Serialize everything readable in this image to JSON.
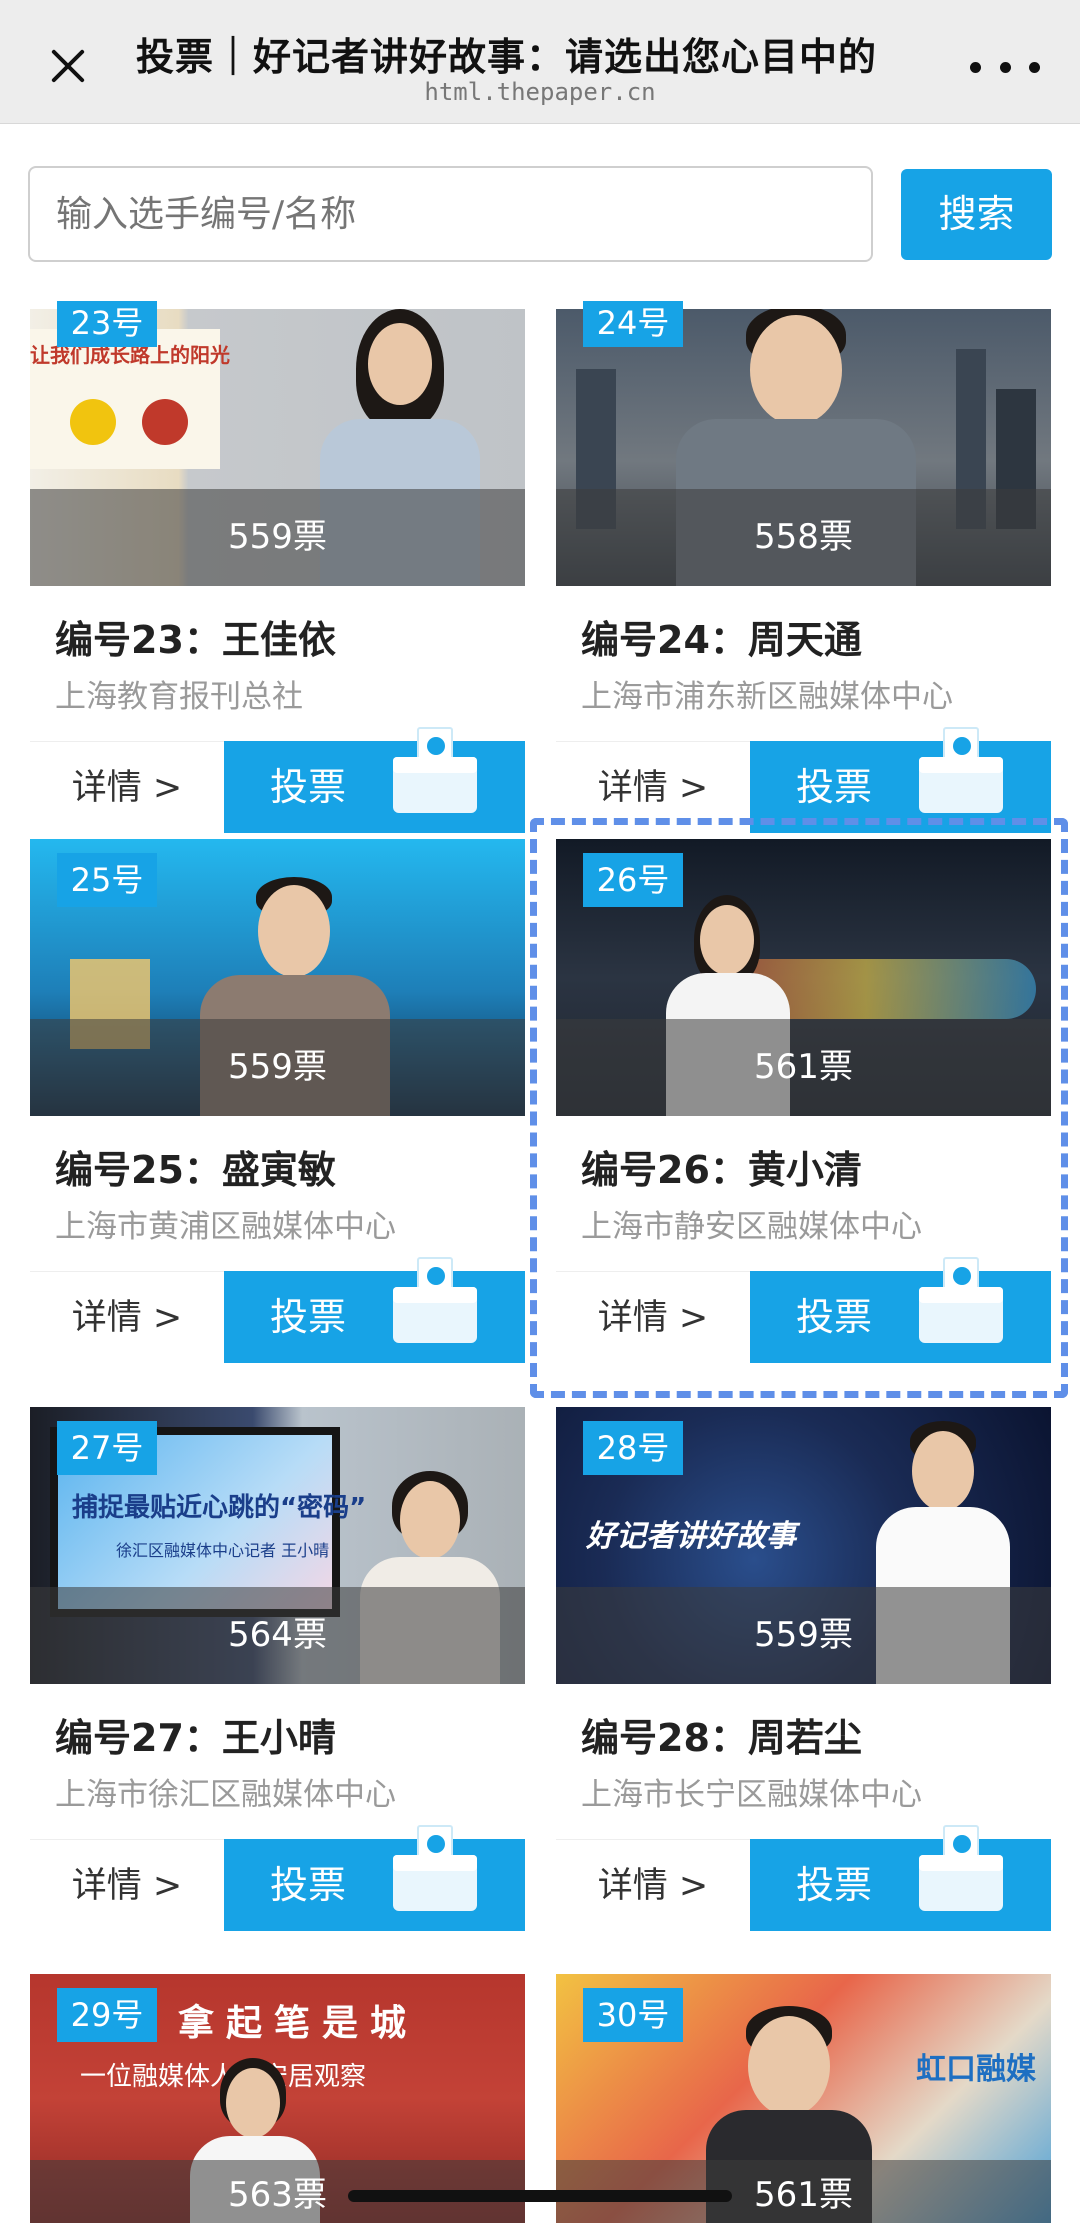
{
  "topbar": {
    "title": "投票｜好记者讲好故事：请选出您心目中的",
    "url": "html.thepaper.cn"
  },
  "search": {
    "placeholder": "输入选手编号/名称",
    "button": "搜索"
  },
  "common": {
    "detail": "详情 >",
    "vote": "投票"
  },
  "candidates": [
    {
      "badge": "23号",
      "votes": "559票",
      "name": "编号23：王佳依",
      "org": "上海教育报刊总社"
    },
    {
      "badge": "24号",
      "votes": "558票",
      "name": "编号24：周天通",
      "org": "上海市浦东新区融媒体中心"
    },
    {
      "badge": "25号",
      "votes": "559票",
      "name": "编号25：盛寅敏",
      "org": "上海市黄浦区融媒体中心"
    },
    {
      "badge": "26号",
      "votes": "561票",
      "name": "编号26：黄小清",
      "org": "上海市静安区融媒体中心"
    },
    {
      "badge": "27号",
      "votes": "564票",
      "name": "编号27：王小晴",
      "org": "上海市徐汇区融媒体中心"
    },
    {
      "badge": "28号",
      "votes": "559票",
      "name": "编号28：周若尘",
      "org": "上海市长宁区融媒体中心"
    },
    {
      "badge": "29号",
      "votes": "563票",
      "name": "",
      "org": ""
    },
    {
      "badge": "30号",
      "votes": "561票",
      "name": "",
      "org": ""
    }
  ],
  "thumb_text": {
    "c23_slide_caption": "让我们成长路上的阳光",
    "c27_slide_line1": "捕捉最贴近心跳的“密码”",
    "c27_slide_line2": "徐汇区融媒体中心记者 王小晴",
    "c28_banner": "好记者讲好故事",
    "c29_headline": "拿起笔是城",
    "c29_subline": "一位融媒体人的安居观察",
    "c30_logo": "虹口融媒"
  }
}
